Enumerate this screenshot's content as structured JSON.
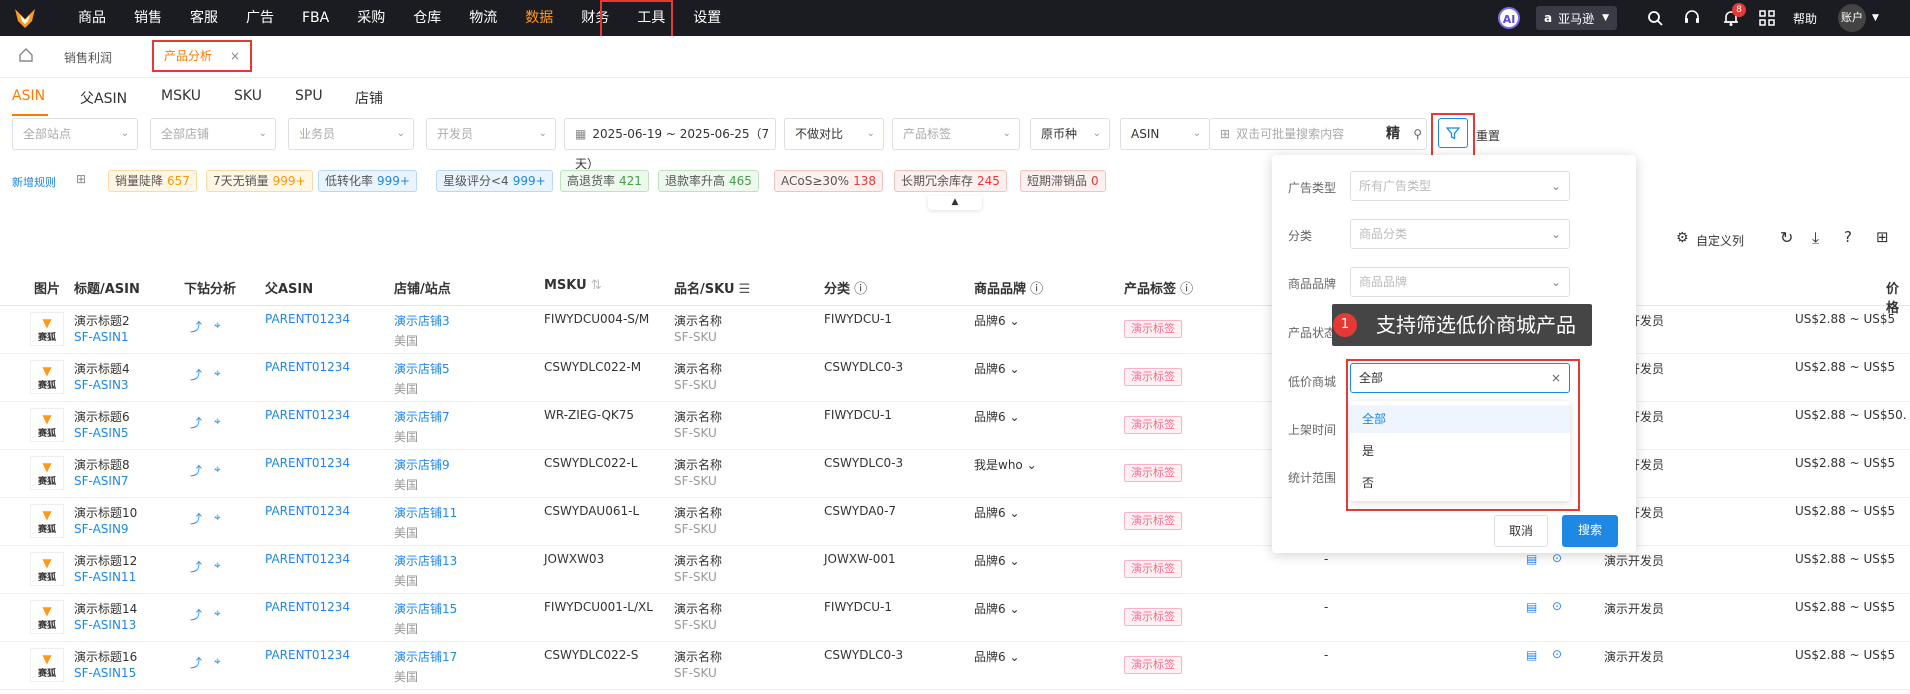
{
  "topnav": {
    "items": [
      "商品",
      "销售",
      "客服",
      "广告",
      "FBA",
      "采购",
      "仓库",
      "物流",
      "数据",
      "财务",
      "工具",
      "设置"
    ],
    "active": "数据",
    "platform": "亚马逊",
    "notification_count": "8",
    "help": "帮助",
    "account": "账户",
    "ai": "AI"
  },
  "page_tabs": {
    "tab1": "销售利润",
    "tab2": "产品分析"
  },
  "dimension_tabs": [
    "ASIN",
    "父ASIN",
    "MSKU",
    "SKU",
    "SPU",
    "店铺"
  ],
  "filters": {
    "site": "全部站点",
    "store": "全部店铺",
    "salesperson": "业务员",
    "developer": "开发员",
    "date_range": "2025-06-19 ~ 2025-06-25（7天）",
    "compare": "不做对比",
    "product_tag": "产品标签",
    "currency": "原币种",
    "search_type": "ASIN",
    "search_placeholder": "双击可批量搜索内容",
    "precise": "精",
    "reset": "重置"
  },
  "rules": {
    "new_rule": "新增规则",
    "chips": [
      {
        "label": "销量陡降",
        "count": "657",
        "color": "#ff9800",
        "bg": "#fff6e6",
        "border": "#ffd8a8"
      },
      {
        "label": "7天无销量",
        "count": "999+",
        "color": "#ff9800",
        "bg": "#fff6e6",
        "border": "#ffd8a8"
      },
      {
        "label": "低转化率",
        "count": "999+",
        "color": "#1e88e5",
        "bg": "#eaf4ff",
        "border": "#b8d8f8"
      },
      {
        "label": "星级评分<4",
        "count": "999+",
        "color": "#1e88e5",
        "bg": "#eaf4ff",
        "border": "#b8d8f8"
      },
      {
        "label": "高退货率",
        "count": "421",
        "color": "#43a047",
        "bg": "#eef8ee",
        "border": "#bfe3bf"
      },
      {
        "label": "退款率升高",
        "count": "465",
        "color": "#43a047",
        "bg": "#eef8ee",
        "border": "#bfe3bf"
      },
      {
        "label": "ACoS≥30%",
        "count": "138",
        "color": "#e53935",
        "bg": "#fff0f0",
        "border": "#f5c2c2"
      },
      {
        "label": "长期冗余库存",
        "count": "245",
        "color": "#e53935",
        "bg": "#fff0f0",
        "border": "#f5c2c2"
      },
      {
        "label": "短期滞销品",
        "count": "0",
        "color": "#e53935",
        "bg": "#fff0f0",
        "border": "#f5c2c2"
      }
    ]
  },
  "toolbar": {
    "custom_columns": "自定义列"
  },
  "table": {
    "headers": {
      "image": "图片",
      "title": "标题/ASIN",
      "drill": "下钻分析",
      "parent": "父ASIN",
      "store": "店铺/站点",
      "msku": "MSKU",
      "name_sku": "品名/SKU",
      "category": "分类",
      "brand": "商品品牌",
      "tag": "产品标签",
      "price": "价格"
    },
    "thumb_text": "赛狐",
    "rows": [
      {
        "title": "演示标题2",
        "asin": "SF-ASIN1",
        "parent": "PARENT01234",
        "store": "演示店铺3",
        "site": "美国",
        "msku": "FIWYDCU004-S/M",
        "name": "演示名称",
        "sku": "SF-SKU",
        "category": "FIWYDCU-1",
        "brand": "品牌6",
        "tag": "演示标签",
        "dev": "演示开发员",
        "dash": "",
        "price": "US$2.88 ~ US$5"
      },
      {
        "title": "演示标题4",
        "asin": "SF-ASIN3",
        "parent": "PARENT01234",
        "store": "演示店铺5",
        "site": "美国",
        "msku": "CSWYDLC022-M",
        "name": "演示名称",
        "sku": "SF-SKU",
        "category": "CSWYDLC0-3",
        "brand": "品牌6",
        "tag": "演示标签",
        "dev": "演示开发员",
        "dash": "",
        "price": "US$2.88 ~ US$5"
      },
      {
        "title": "演示标题6",
        "asin": "SF-ASIN5",
        "parent": "PARENT01234",
        "store": "演示店铺7",
        "site": "美国",
        "msku": "WR-ZIEG-QK75",
        "name": "演示名称",
        "sku": "SF-SKU",
        "category": "FIWYDCU-1",
        "brand": "品牌6",
        "tag": "演示标签",
        "dev": "演示开发员",
        "dash": "",
        "price": "US$2.88 ~ US$50."
      },
      {
        "title": "演示标题8",
        "asin": "SF-ASIN7",
        "parent": "PARENT01234",
        "store": "演示店铺9",
        "site": "美国",
        "msku": "CSWYDLC022-L",
        "name": "演示名称",
        "sku": "SF-SKU",
        "category": "CSWYDLC0-3",
        "brand": "我是who",
        "tag": "演示标签",
        "dev": "演示开发员",
        "dash": "",
        "price": "US$2.88 ~ US$5"
      },
      {
        "title": "演示标题10",
        "asin": "SF-ASIN9",
        "parent": "PARENT01234",
        "store": "演示店铺11",
        "site": "美国",
        "msku": "CSWYDAU061-L",
        "name": "演示名称",
        "sku": "SF-SKU",
        "category": "CSWYDA0-7",
        "brand": "品牌6",
        "tag": "演示标签",
        "dev": "演示开发员",
        "dash": "",
        "price": "US$2.88 ~ US$5"
      },
      {
        "title": "演示标题12",
        "asin": "SF-ASIN11",
        "parent": "PARENT01234",
        "store": "演示店铺13",
        "site": "美国",
        "msku": "JOWXW03",
        "name": "演示名称",
        "sku": "SF-SKU",
        "category": "JOWXW-001",
        "brand": "品牌6",
        "tag": "演示标签",
        "dev": "演示开发员",
        "dash": "-",
        "price": "US$2.88 ~ US$5"
      },
      {
        "title": "演示标题14",
        "asin": "SF-ASIN13",
        "parent": "PARENT01234",
        "store": "演示店铺15",
        "site": "美国",
        "msku": "FIWYDCU001-L/XL",
        "name": "演示名称",
        "sku": "SF-SKU",
        "category": "FIWYDCU-1",
        "brand": "品牌6",
        "tag": "演示标签",
        "dev": "演示开发员",
        "dash": "-",
        "price": "US$2.88 ~ US$5"
      },
      {
        "title": "演示标题16",
        "asin": "SF-ASIN15",
        "parent": "PARENT01234",
        "store": "演示店铺17",
        "site": "美国",
        "msku": "CSWYDLC022-S",
        "name": "演示名称",
        "sku": "SF-SKU",
        "category": "CSWYDLC0-3",
        "brand": "品牌6",
        "tag": "演示标签",
        "dev": "演示开发员",
        "dash": "-",
        "price": "US$2.88 ~ US$5"
      }
    ]
  },
  "filter_panel": {
    "ad_type_label": "广告类型",
    "ad_type_placeholder": "所有广告类型",
    "category_label": "分类",
    "category_placeholder": "商品分类",
    "brand_label": "商品品牌",
    "brand_placeholder": "商品品牌",
    "status_label": "产品状态",
    "lowprice_label": "低价商城",
    "lowprice_value": "全部",
    "listed_label": "上架时间",
    "stats_label": "统计范围",
    "options": [
      "全部",
      "是",
      "否"
    ],
    "cancel": "取消",
    "search": "搜索"
  },
  "tooltip": {
    "number": "1",
    "text": "支持筛选低价商城产品"
  }
}
